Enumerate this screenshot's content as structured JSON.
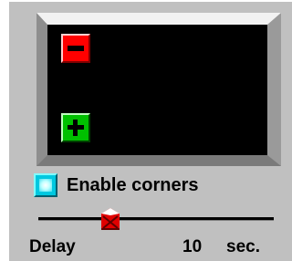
{
  "monitor": {
    "corner_minus_icon": "minus-icon",
    "corner_plus_icon": "plus-icon",
    "colors": {
      "screen": "#000000",
      "minus": "#ff0000",
      "plus": "#00c000"
    }
  },
  "corners": {
    "label": "Enable corners",
    "checked": true,
    "checkbox_color": "#00c8e0"
  },
  "delay": {
    "label": "Delay",
    "value": "10",
    "unit": "sec.",
    "slider_position": 0.35
  }
}
